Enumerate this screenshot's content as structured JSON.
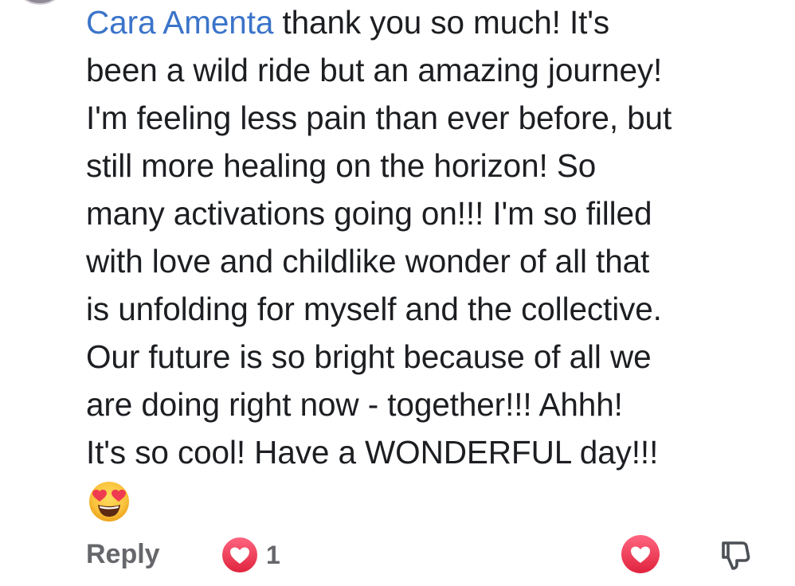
{
  "comment": {
    "author": "Cara Amenta",
    "lines": [
      "thank you so much! It's",
      "been a wild ride but an amazing journey!",
      "I'm feeling less pain than ever before, but",
      "still more healing on the horizon! So",
      "many activations going on!!! I'm so filled",
      "with love and childlike wonder of all that",
      "is unfolding for myself and the collective.",
      "Our future is so bright because of all we",
      "are doing right now - together!!! Ahhh!",
      "It's so cool! Have a WONDERFUL day!!!"
    ],
    "emoji": "heart-eyes-emoji"
  },
  "actions": {
    "reply_label": "Reply",
    "reaction_count": "1",
    "reaction_icon": "heart-reaction-icon",
    "react_icon": "heart-outline-icon",
    "downvote_icon": "thumbs-down-outline-icon"
  },
  "colors": {
    "author": "#3b74c9",
    "action_text": "#65676b",
    "heart_red": "#f0334f"
  }
}
